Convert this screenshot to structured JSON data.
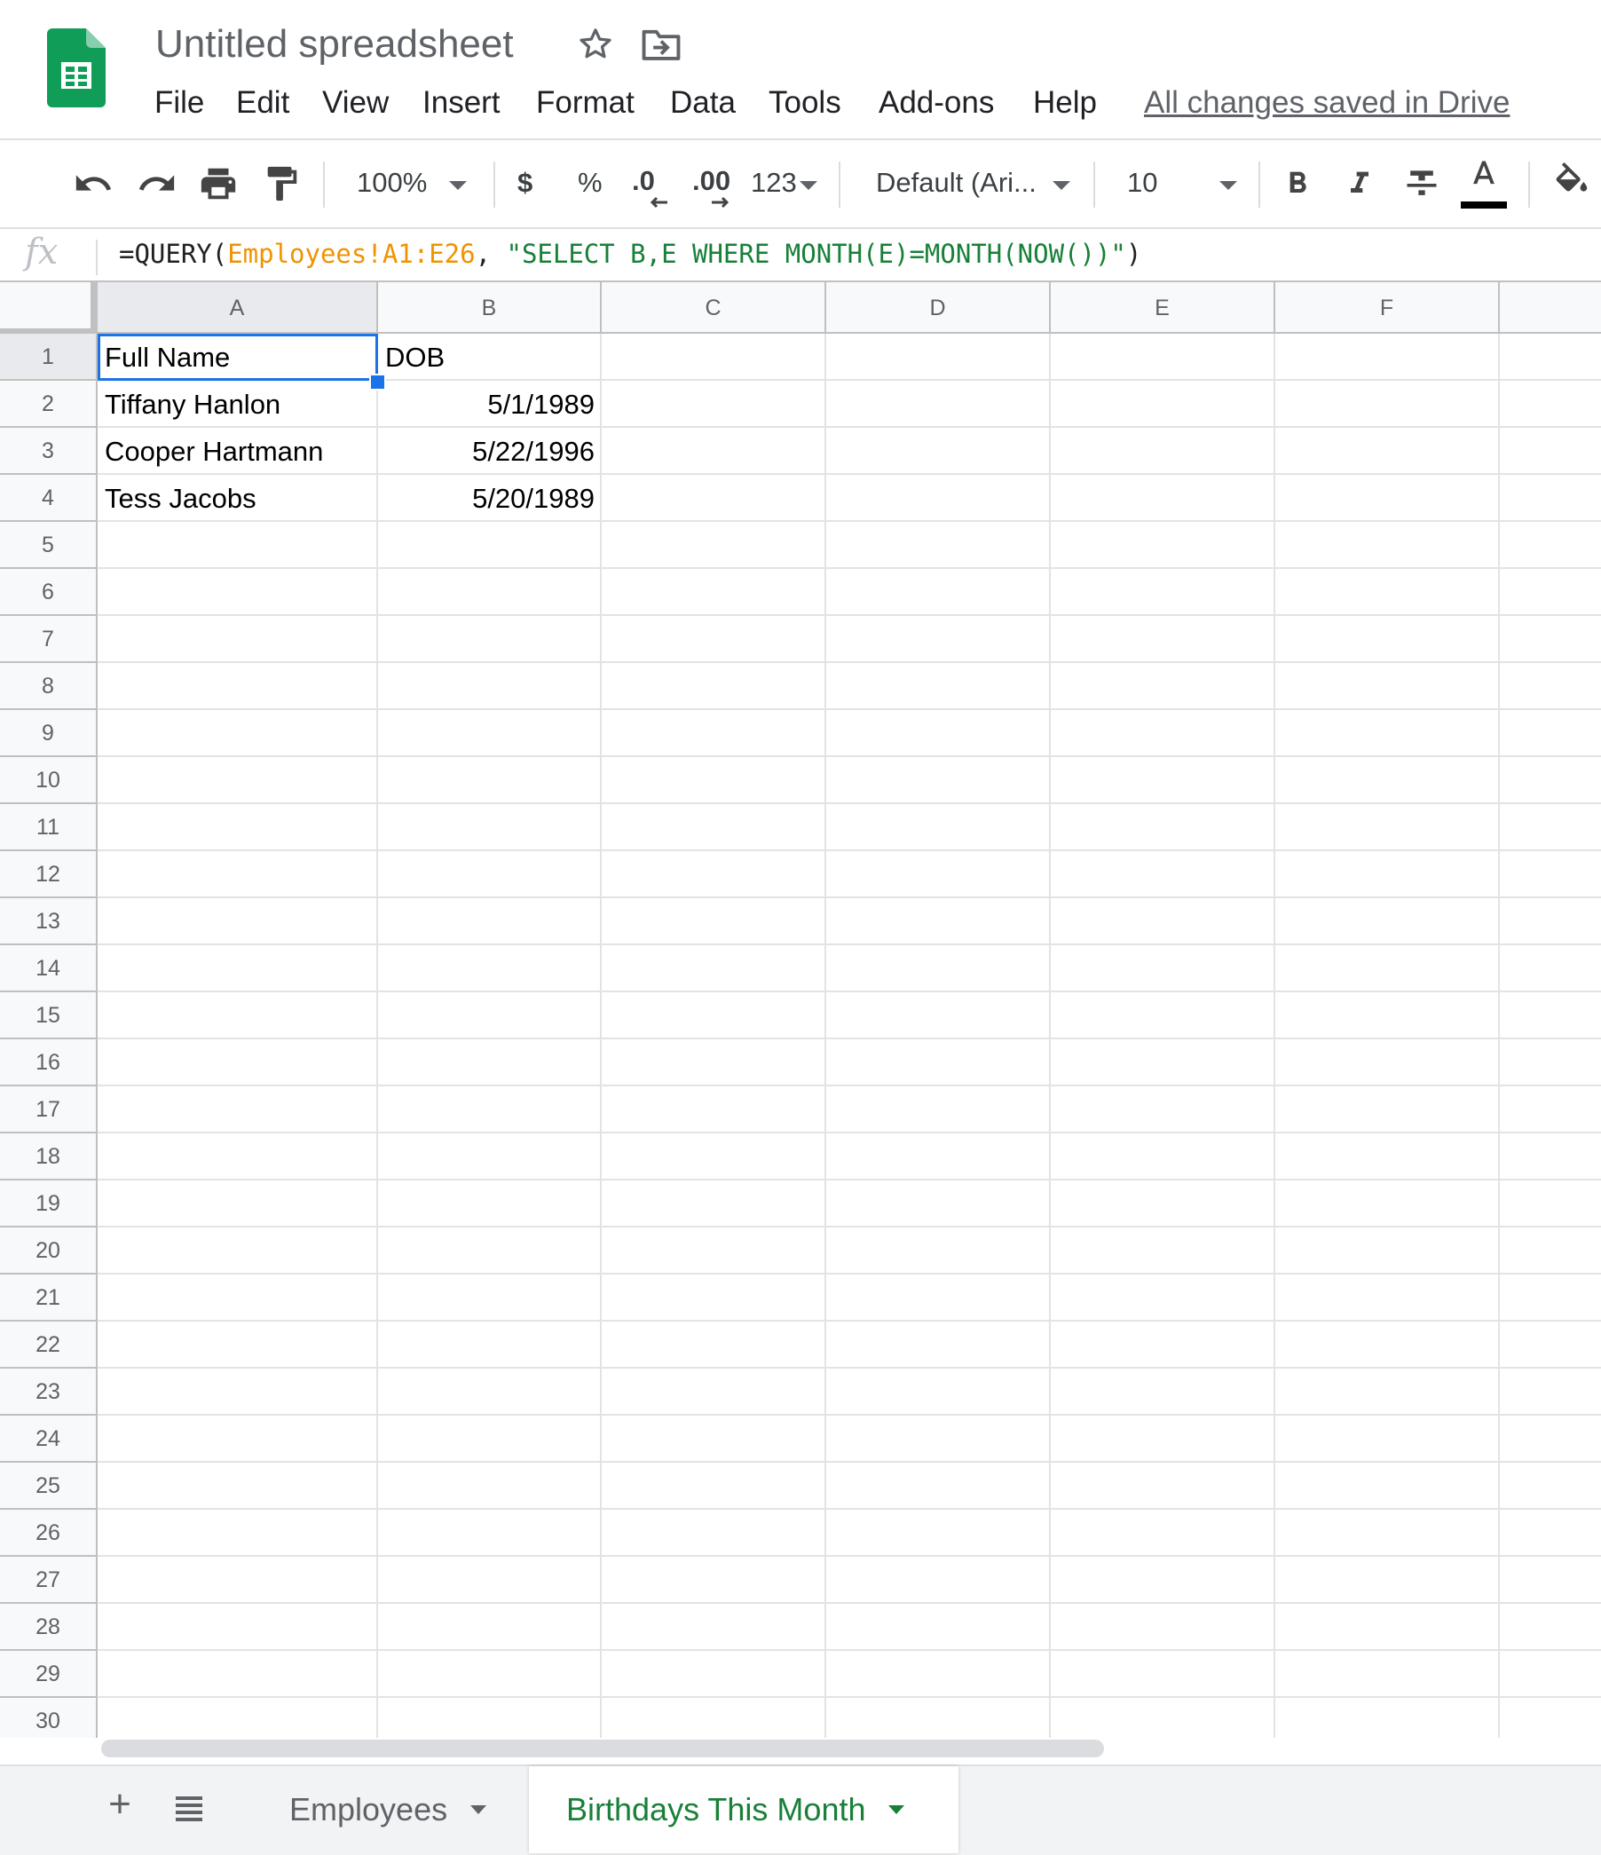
{
  "app": {
    "doc_title": "Untitled spreadsheet",
    "save_status": "All changes saved in Drive",
    "icons": [
      "sheets-logo-icon",
      "star-icon",
      "move-to-folder-icon"
    ]
  },
  "menu": [
    "File",
    "Edit",
    "View",
    "Insert",
    "Format",
    "Data",
    "Tools",
    "Add-ons",
    "Help"
  ],
  "toolbar": {
    "zoom": "100%",
    "currency": "$",
    "percent": "%",
    "decrease_decimal": ".0",
    "increase_decimal": ".00",
    "more_formats": "123",
    "font_family": "Default (Ari...",
    "font_size": "10",
    "icons": [
      "undo-icon",
      "redo-icon",
      "print-icon",
      "paint-format-icon",
      "bold-icon",
      "italic-icon",
      "strikethrough-icon",
      "text-color-icon",
      "fill-color-icon"
    ]
  },
  "formula_bar": {
    "fx_label": "fx",
    "prefix": "=QUERY(",
    "range": "Employees!A1:E26",
    "middle": ", ",
    "query": "\"SELECT B,E WHERE MONTH(E)=MONTH(NOW())\"",
    "suffix": ")"
  },
  "grid": {
    "columns": [
      "A",
      "B",
      "C",
      "D",
      "E",
      "F"
    ],
    "row_count": 30,
    "active_cell": "A1",
    "cells": [
      [
        "Full Name",
        "DOB"
      ],
      [
        "Tiffany Hanlon",
        "5/1/1989"
      ],
      [
        "Cooper Hartmann",
        "5/22/1996"
      ],
      [
        "Tess Jacobs",
        "5/20/1989"
      ]
    ]
  },
  "sheets": {
    "tabs": [
      {
        "label": "Employees",
        "active": false
      },
      {
        "label": "Birthdays This Month",
        "active": true
      }
    ],
    "accent_color": "#188038"
  },
  "colors": {
    "selection": "#1a73e8",
    "formula_range": "#f09300",
    "formula_string": "#188038"
  }
}
